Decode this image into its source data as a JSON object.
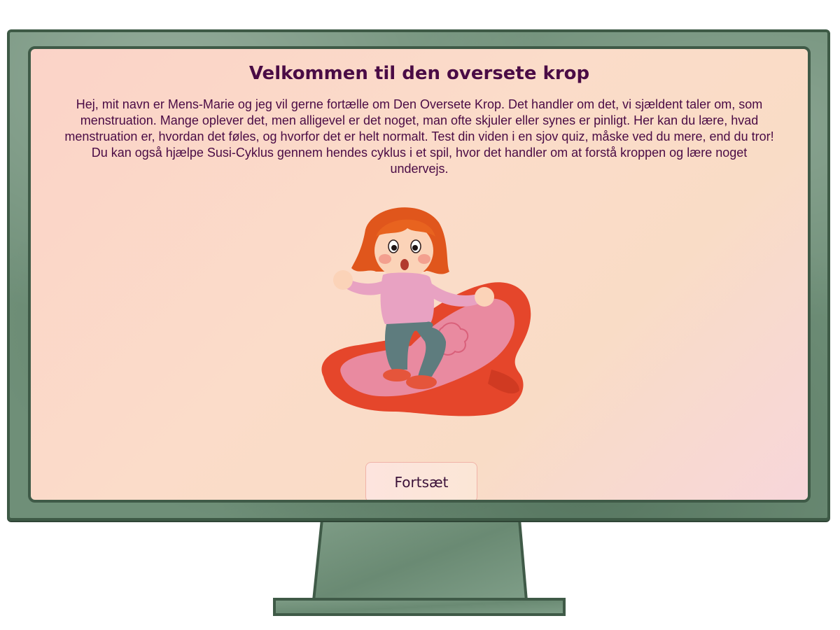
{
  "screen": {
    "title": "Velkommen til den oversete krop",
    "intro": "Hej, mit navn er Mens-Marie og jeg vil gerne fortælle om Den Oversete Krop. Det handler om det, vi sjældent taler om, som menstruation. Mange oplever det, men alligevel er det noget, man ofte skjuler eller synes er pinligt. Her kan du lære, hvad menstruation er, hvordan det føles, og hvorfor det er helt normalt. Test din viden i en sjov quiz, måske ved du mere, end du tror! Du kan også hjælpe Susi-Cyklus gennem hendes cyklus i et spil, hvor det handler om at forstå kroppen og lære noget undervejs.",
    "continue_label": "Fortsæt"
  },
  "illustration": {
    "name": "girl-on-sanitary-pad-illustration"
  },
  "colors": {
    "title": "#4a0b45",
    "frame": "#6f8f78",
    "frame_border": "#3e5a46",
    "screen_bg": "#fbd8c8"
  }
}
